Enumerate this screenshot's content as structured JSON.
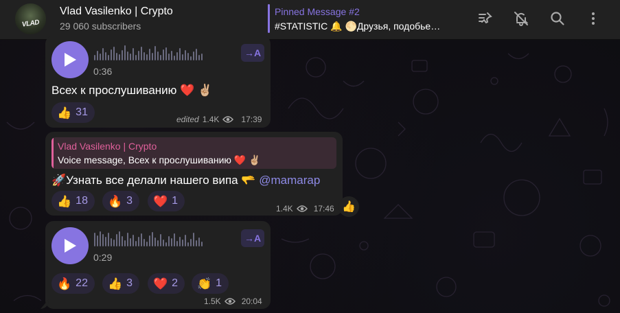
{
  "header": {
    "channel_title": "Vlad Vasilenko | Crypto",
    "subscribers": "29 060 subscribers",
    "avatar_text": "VLAD",
    "pinned_title": "Pinned Message #2",
    "pinned_text": "#STATISTIC 🔔 🌕Друзья, подобье…",
    "icons": [
      "pin-list-icon",
      "mute-bell-icon",
      "search-icon",
      "more-vertical-icon"
    ]
  },
  "messages": [
    {
      "type": "voice",
      "duration": "0:36",
      "transcribe_label": "→A",
      "text": "Всех к прослушиванию ❤️ ✌🏼",
      "reactions": [
        {
          "emoji": "👍",
          "count": "31"
        }
      ],
      "edited": "edited",
      "views": "1.4K",
      "time": "17:39"
    },
    {
      "type": "text",
      "reply_author": "Vlad Vasilenko | Crypto",
      "reply_text": "Voice message, Всех к прослушиванию ❤️ ✌🏼",
      "text_prefix": "🚀Узнать все делали нашего випа 🫳 ",
      "mention": "@mamarap",
      "reactions": [
        {
          "emoji": "👍",
          "count": "18"
        },
        {
          "emoji": "🔥",
          "count": "3"
        },
        {
          "emoji": "❤️",
          "count": "1"
        }
      ],
      "views": "1.4K",
      "time": "17:46",
      "quick_reaction": "👍"
    },
    {
      "type": "voice",
      "duration": "0:29",
      "transcribe_label": "→A",
      "reactions": [
        {
          "emoji": "🔥",
          "count": "22"
        },
        {
          "emoji": "👍",
          "count": "3"
        },
        {
          "emoji": "❤️",
          "count": "2"
        },
        {
          "emoji": "👏",
          "count": "1"
        }
      ],
      "views": "1.5K",
      "time": "20:04"
    }
  ],
  "colors": {
    "accent": "#8774e1",
    "bubble": "#212121",
    "header": "#212121",
    "reply_accent": "#e0609b",
    "reaction_bg": "#2a2638"
  }
}
